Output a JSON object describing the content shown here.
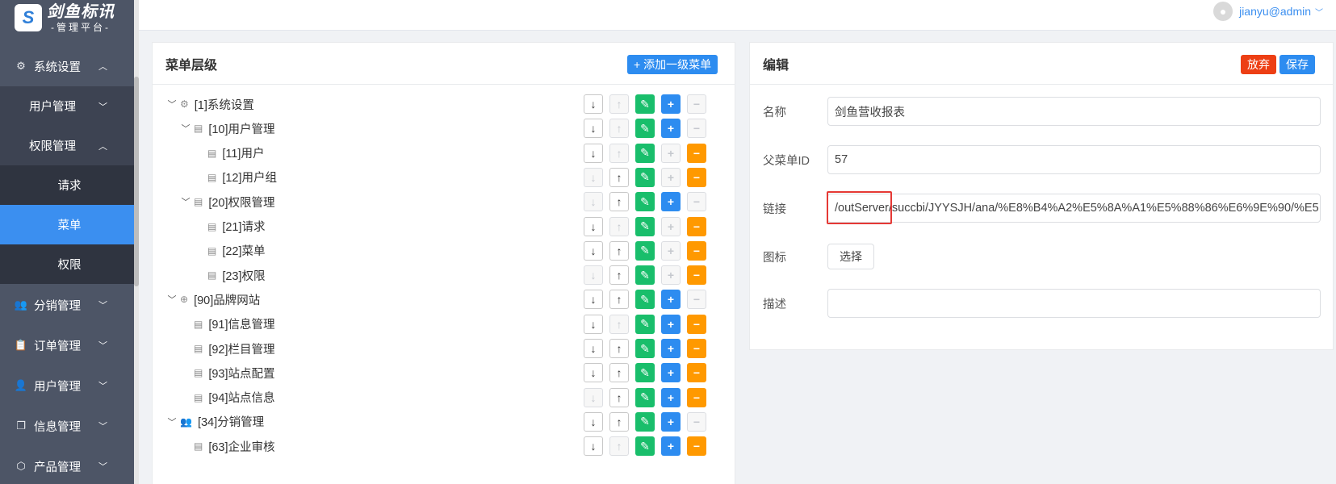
{
  "brand": {
    "logo_glyph": "S",
    "title": "剑鱼标讯",
    "subtitle": "-管理平台-"
  },
  "user": {
    "name": "jianyu@admin"
  },
  "sidebar": {
    "items": [
      {
        "label": "系统设置",
        "icon": "gear-icon",
        "expanded": true
      },
      {
        "label": "用户管理",
        "level": "sub"
      },
      {
        "label": "权限管理",
        "level": "sub",
        "expanded": true
      },
      {
        "label": "请求",
        "level": "leaf"
      },
      {
        "label": "菜单",
        "level": "leaf",
        "active": true
      },
      {
        "label": "权限",
        "level": "leaf"
      },
      {
        "label": "分销管理",
        "icon": "people-icon"
      },
      {
        "label": "订单管理",
        "icon": "clipboard-icon"
      },
      {
        "label": "用户管理",
        "icon": "person-icon"
      },
      {
        "label": "信息管理",
        "icon": "message-icon"
      },
      {
        "label": "产品管理",
        "icon": "box-icon"
      }
    ]
  },
  "menu_panel": {
    "title": "菜单层级",
    "add_button": "+ 添加一级菜单",
    "tree": [
      {
        "label": "[1]系统设置",
        "icon": "gear-icon",
        "caret": true
      },
      {
        "label": "[10]用户管理",
        "icon": "doc-icon",
        "caret": true
      },
      {
        "label": "[11]用户",
        "icon": "doc-icon"
      },
      {
        "label": "[12]用户组",
        "icon": "doc-icon"
      },
      {
        "label": "[20]权限管理",
        "icon": "doc-icon",
        "caret": true
      },
      {
        "label": "[21]请求",
        "icon": "doc-icon"
      },
      {
        "label": "[22]菜单",
        "icon": "doc-icon"
      },
      {
        "label": "[23]权限",
        "icon": "doc-icon"
      },
      {
        "label": "[90]品牌网站",
        "icon": "globe-icon",
        "caret": true
      },
      {
        "label": "[91]信息管理",
        "icon": "doc-icon"
      },
      {
        "label": "[92]栏目管理",
        "icon": "doc-icon"
      },
      {
        "label": "[93]站点配置",
        "icon": "doc-icon"
      },
      {
        "label": "[94]站点信息",
        "icon": "doc-icon"
      },
      {
        "label": "[34]分销管理",
        "icon": "people-icon",
        "caret": true
      },
      {
        "label": "[63]企业审核",
        "icon": "doc-icon"
      }
    ]
  },
  "edit_panel": {
    "title": "编辑",
    "discard_button": "放弃",
    "save_button": "保存",
    "fields": {
      "name_label": "名称",
      "name_value": "剑鱼营收报表",
      "parent_label": "父菜单ID",
      "parent_value": "57",
      "link_label": "链接",
      "link_value": "/outServer/succbi/JYYSJH/ana/%E8%B4%A2%E5%8A%A1%E5%88%86%E6%9E%90/%E5",
      "icon_label": "图标",
      "icon_button": "选择",
      "desc_label": "描述",
      "desc_value": ""
    }
  },
  "colors": {
    "sidebar": "#4d5566",
    "active": "#3b8ff0",
    "edit": "#19be6b",
    "add": "#2d8cf0",
    "remove": "#ff9900",
    "danger": "#ed3f14"
  }
}
